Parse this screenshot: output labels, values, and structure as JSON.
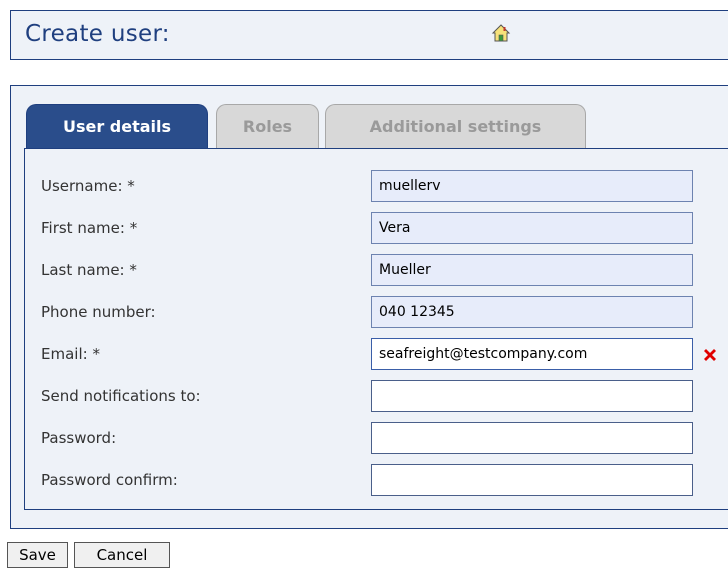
{
  "header": {
    "title": "Create user:",
    "home_icon": "home-icon"
  },
  "tabs": [
    {
      "label": "User details",
      "active": true
    },
    {
      "label": "Roles",
      "active": false
    },
    {
      "label": "Additional settings",
      "active": false
    }
  ],
  "form": {
    "fields": [
      {
        "label": "Username: *",
        "value": "muellerv"
      },
      {
        "label": "First name: *",
        "value": "Vera"
      },
      {
        "label": "Last name: *",
        "value": "Mueller"
      },
      {
        "label": "Phone number:",
        "value": "040 12345"
      },
      {
        "label": "Email: *",
        "value": "seafreight@testcompany.com",
        "error_icon": "error-cross-icon"
      },
      {
        "label": "Send notifications to:",
        "value": ""
      },
      {
        "label": "Password:",
        "value": ""
      },
      {
        "label": "Password confirm:",
        "value": ""
      }
    ]
  },
  "buttons": {
    "save": "Save",
    "cancel": "Cancel"
  },
  "colors": {
    "accent": "#2a4d8b",
    "panel_bg": "#eef2f8",
    "error": "#e00000"
  }
}
